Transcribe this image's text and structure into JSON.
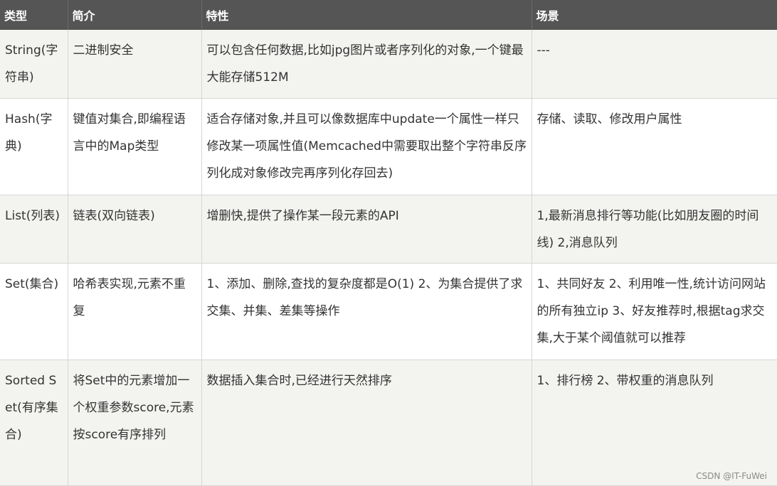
{
  "table": {
    "headers": [
      "类型",
      "简介",
      "特性",
      "场景"
    ],
    "rows": [
      {
        "type": "String(字符串)",
        "intro": "二进制安全",
        "feature": "可以包含任何数据,比如jpg图片或者序列化的对象,一个键最大能存储512M",
        "scene": "---"
      },
      {
        "type": "Hash(字典)",
        "intro": "键值对集合,即编程语言中的Map类型",
        "feature": "适合存储对象,并且可以像数据库中update一个属性一样只修改某一项属性值(Memcached中需要取出整个字符串反序列化成对象修改完再序列化存回去)",
        "scene": "存储、读取、修改用户属性"
      },
      {
        "type": "List(列表)",
        "intro": "链表(双向链表)",
        "feature": "增删快,提供了操作某一段元素的API",
        "scene": "1,最新消息排行等功能(比如朋友圈的时间线) 2,消息队列"
      },
      {
        "type": "Set(集合)",
        "intro": "哈希表实现,元素不重复",
        "feature": "1、添加、删除,查找的复杂度都是O(1) 2、为集合提供了求交集、并集、差集等操作",
        "scene": "1、共同好友 2、利用唯一性,统计访问网站的所有独立ip 3、好友推荐时,根据tag求交集,大于某个阈值就可以推荐"
      },
      {
        "type": "Sorted Set(有序集合)",
        "intro": "将Set中的元素增加一个权重参数score,元素按score有序排列",
        "feature": "数据插入集合时,已经进行天然排序",
        "scene": "1、排行榜 2、带权重的消息队列"
      }
    ]
  },
  "watermark": "CSDN @IT-FuWei"
}
